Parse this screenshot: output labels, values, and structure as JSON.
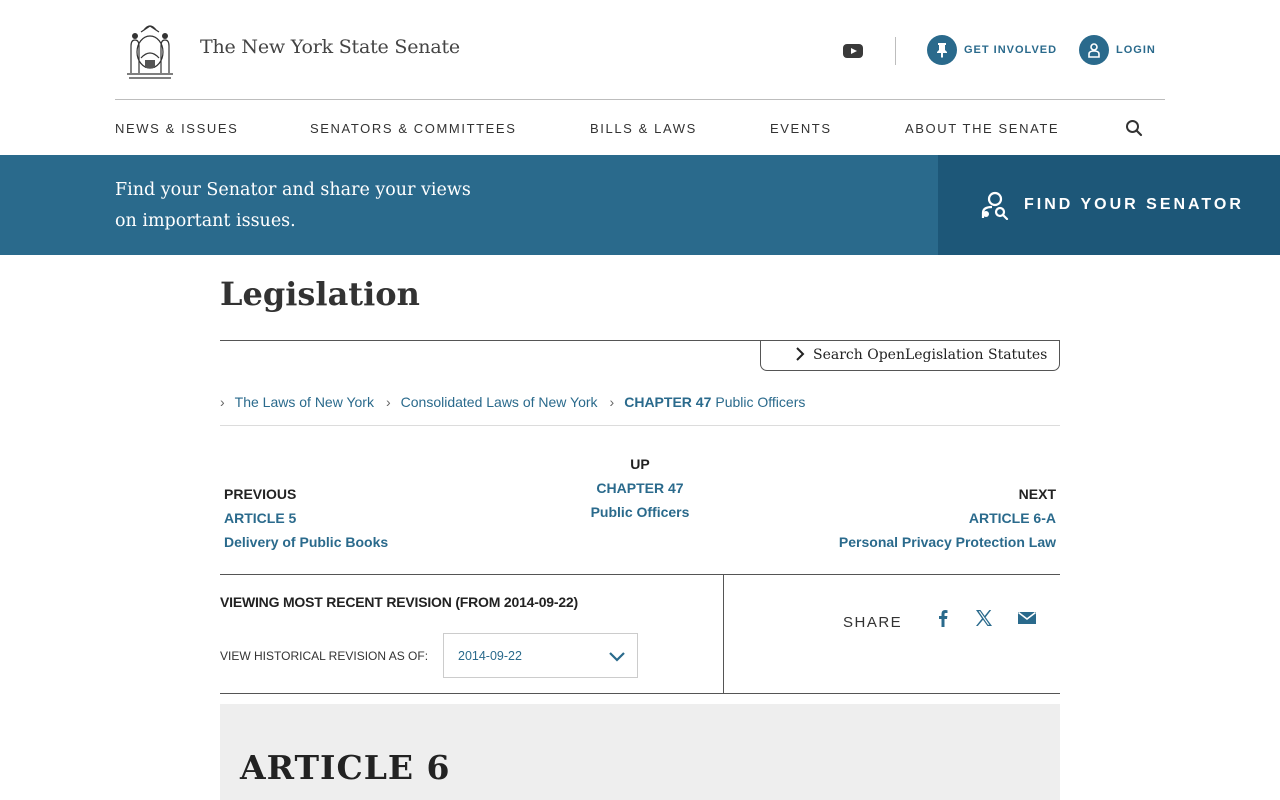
{
  "header": {
    "site_title": "The New York State Senate",
    "get_involved": "GET INVOLVED",
    "login": "LOGIN"
  },
  "nav": {
    "items": [
      "NEWS & ISSUES",
      "SENATORS & COMMITTEES",
      "BILLS & LAWS",
      "EVENTS",
      "ABOUT THE SENATE"
    ]
  },
  "banner": {
    "text": "Find your Senator and share your views on important issues.",
    "find_button": "FIND YOUR SENATOR"
  },
  "main": {
    "title": "Legislation",
    "search_statutes": "Search OpenLegislation Statutes",
    "breadcrumbs": [
      {
        "text": "The Laws of New York"
      },
      {
        "text": "Consolidated Laws of New York"
      },
      {
        "text": "CHAPTER 47",
        "suffix": "Public Officers"
      }
    ],
    "previous": {
      "label": "PREVIOUS",
      "code": "ARTICLE 5",
      "name": "Delivery of Public Books"
    },
    "up": {
      "label": "UP",
      "code": "CHAPTER 47",
      "name": "Public Officers"
    },
    "next": {
      "label": "NEXT",
      "code": "ARTICLE 6-A",
      "name": "Personal Privacy Protection Law"
    },
    "revision": {
      "title": "VIEWING MOST RECENT REVISION (FROM 2014-09-22)",
      "label": "VIEW HISTORICAL REVISION AS OF:",
      "selected": "2014-09-22"
    },
    "share_label": "SHARE",
    "article_title": "ARTICLE 6"
  },
  "colors": {
    "accent": "#2a6a8c",
    "accent_dark": "#1d5778",
    "article_bg": "#eeeeee"
  },
  "icons": {
    "seal": "ny-seal-icon",
    "youtube": "youtube-icon",
    "get_involved": "pushpin-icon",
    "login": "user-icon",
    "search": "search-icon",
    "find": "senator-locator-icon",
    "facebook": "facebook-icon",
    "x": "x-icon",
    "email": "email-icon"
  }
}
